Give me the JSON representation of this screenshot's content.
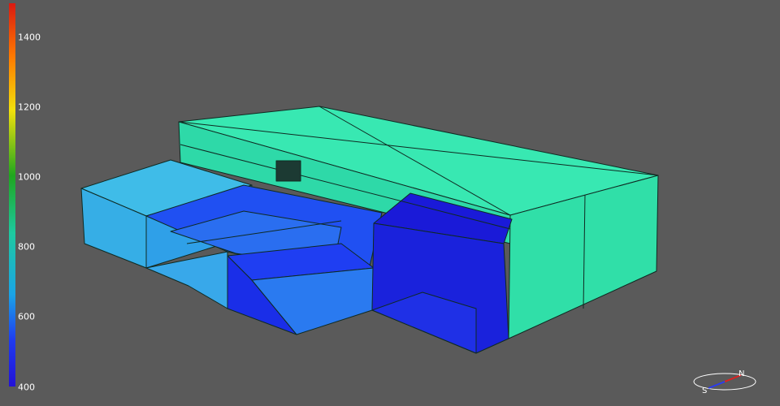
{
  "legend": {
    "ticks": [
      "1400",
      "1200",
      "1000",
      "800",
      "600",
      "400"
    ]
  },
  "compass": {
    "north": "N",
    "south": "S"
  },
  "colors": {
    "background": "#5a5a5a",
    "high_roof": "#33e6b0",
    "low_wing": "#38b2e6",
    "dark_blue": "#1a1ae0",
    "mid_blue": "#1f5cf0"
  }
}
